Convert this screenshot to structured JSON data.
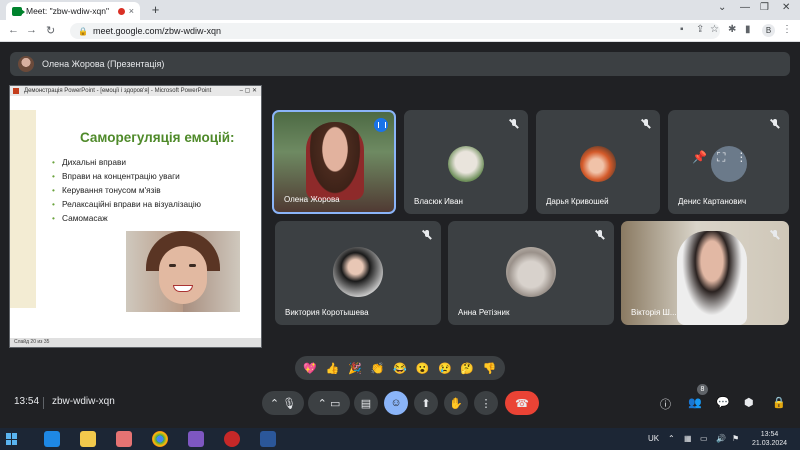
{
  "browser": {
    "tab_title": "Meet: \"zbw-wdiw-xqn\"",
    "tab_close": "×",
    "new_tab": "+",
    "url": "meet.google.com/zbw-wdiw-xqn",
    "profile_initial": "B"
  },
  "presenter_banner": {
    "text": "Олена Жорова (Презентація)"
  },
  "presentation": {
    "window_title": "Демонстрація PowerPoint - [емоції і здоров'я] - Microsoft PowerPoint",
    "slide_title": "Саморегуляція емоцій:",
    "bullets": [
      "Дихальні вправи",
      "Вправи на концентрацію уваги",
      "Керування тонусом м'язів",
      "Релаксаційні вправи на візуалізацію",
      "Самомасаж"
    ],
    "status": "Слайд 20 из 35"
  },
  "participants": [
    {
      "name": "Олена Жорова",
      "muted": false,
      "speaking": true
    },
    {
      "name": "Власюк Иван",
      "muted": true
    },
    {
      "name": "Дарья Кривошей",
      "muted": true
    },
    {
      "name": "Денис Картанович",
      "muted": true
    },
    {
      "name": "Виктория Коротышева",
      "muted": true
    },
    {
      "name": "Анна Ретізник",
      "muted": true
    },
    {
      "name": "Вікторія Ш...",
      "muted": true
    }
  ],
  "reactions": [
    "💖",
    "👍",
    "🎉",
    "👏",
    "😂",
    "😮",
    "😢",
    "🤔",
    "👎"
  ],
  "controls": {
    "time": "13:54",
    "meeting_code": "zbw-wdiw-xqn",
    "participant_count": "8"
  },
  "taskbar": {
    "language": "UK",
    "time": "13:54",
    "date": "21.03.2024"
  },
  "colors": {
    "meet_bg": "#202124",
    "tile_bg": "#3c4043",
    "hangup": "#ea4335",
    "active_border": "#8ab4f8",
    "slide_title": "#4f8a2a"
  }
}
